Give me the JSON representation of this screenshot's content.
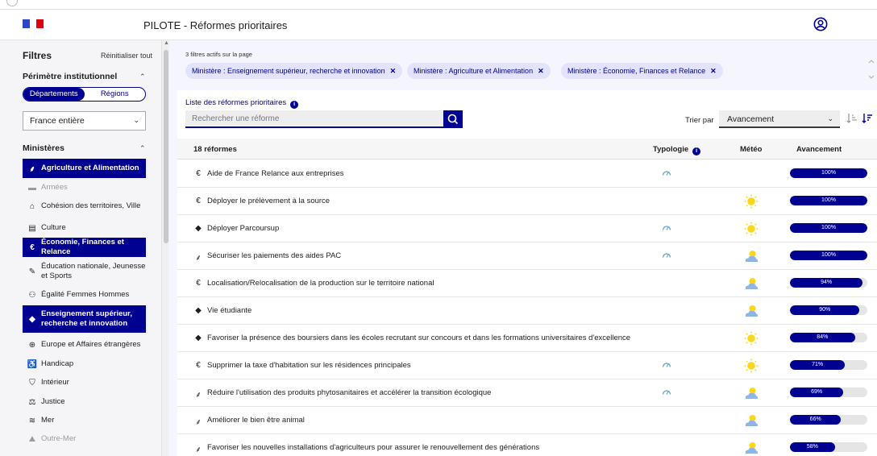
{
  "app": {
    "title": "PILOTE - Réformes prioritaires"
  },
  "sidebar": {
    "filters_title": "Filtres",
    "reset_label": "Réinitialiser tout",
    "perimetre_title": "Périmètre institutionnel",
    "toggle": {
      "left": "Départements",
      "right": "Régions",
      "selected": "Départements"
    },
    "territory_select": "France entière",
    "ministeres_title": "Ministères",
    "ministeres": [
      {
        "label": "Agriculture et Alimentation",
        "icon": "wheat-icon",
        "state": "active"
      },
      {
        "label": "Armées",
        "icon": "tank-icon",
        "state": "disabled"
      },
      {
        "label": "Cohésion des territoires, Ville",
        "icon": "house-icon",
        "state": "normal"
      },
      {
        "label": "Culture",
        "icon": "book-icon",
        "state": "normal"
      },
      {
        "label": "Économie, Finances et Relance",
        "icon": "euro-icon",
        "state": "active"
      },
      {
        "label": "Éducation nationale, Jeunesse et Sports",
        "icon": "pencil-icon",
        "state": "normal"
      },
      {
        "label": "Égalité Femmes Hommes",
        "icon": "people-icon",
        "state": "normal"
      },
      {
        "label": "Enseignement supérieur, recherche et innovation",
        "icon": "graduation-cap-icon",
        "state": "active"
      },
      {
        "label": "Europe et Affaires étrangères",
        "icon": "globe-icon",
        "state": "normal"
      },
      {
        "label": "Handicap",
        "icon": "wheelchair-icon",
        "state": "normal"
      },
      {
        "label": "Intérieur",
        "icon": "shield-icon",
        "state": "normal"
      },
      {
        "label": "Justice",
        "icon": "scales-icon",
        "state": "normal"
      },
      {
        "label": "Mer",
        "icon": "waves-icon",
        "state": "normal"
      },
      {
        "label": "Outre-Mer",
        "icon": "island-icon",
        "state": "disabled"
      }
    ]
  },
  "filters": {
    "count_text": "3 filtres actifs sur la page",
    "chips": [
      "Ministère : Enseignement supérieur, recherche et innovation",
      "Ministère : Agriculture et Alimentation",
      "Ministère : Économie, Finances et Relance"
    ]
  },
  "list": {
    "title": "Liste des réformes prioritaires",
    "search_placeholder": "Rechercher une réforme",
    "sort_label": "Trier par",
    "sort_value": "Avancement",
    "columns": {
      "count": "18 réformes",
      "typologie": "Typologie",
      "meteo": "Météo",
      "avancement": "Avancement"
    },
    "rows": [
      {
        "name": "Aide de France Relance aux entreprises",
        "icon": "euro-icon",
        "typologie": true,
        "meteo": "none",
        "progress": 100,
        "progress_label": "100%"
      },
      {
        "name": "Déployer le prélèvement à la source",
        "icon": "euro-icon",
        "typologie": false,
        "meteo": "sunny",
        "progress": 100,
        "progress_label": "100%"
      },
      {
        "name": "Déployer Parcoursup",
        "icon": "graduation-cap-icon",
        "typologie": true,
        "meteo": "sunny",
        "progress": 100,
        "progress_label": "100%"
      },
      {
        "name": "Sécuriser les paiements des aides PAC",
        "icon": "wheat-icon",
        "typologie": true,
        "meteo": "partly-cloudy",
        "progress": 100,
        "progress_label": "100%"
      },
      {
        "name": "Localisation/Relocalisation de la production sur le territoire national",
        "icon": "euro-icon",
        "typologie": false,
        "meteo": "partly-cloudy",
        "progress": 94,
        "progress_label": "94%"
      },
      {
        "name": "Vie étudiante",
        "icon": "graduation-cap-icon",
        "typologie": false,
        "meteo": "partly-cloudy",
        "progress": 90,
        "progress_label": "90%"
      },
      {
        "name": "Favoriser la présence des boursiers dans les écoles recrutant sur concours et dans les formations universitaires d'excellence",
        "icon": "graduation-cap-icon",
        "typologie": false,
        "meteo": "sunny",
        "progress": 84,
        "progress_label": "84%"
      },
      {
        "name": "Supprimer la taxe d'habitation sur les résidences principales",
        "icon": "euro-icon",
        "typologie": true,
        "meteo": "sunny",
        "progress": 71,
        "progress_label": "71%"
      },
      {
        "name": "Réduire l'utilisation des produits phytosanitaires et accélérer la transition écologique",
        "icon": "wheat-icon",
        "typologie": true,
        "meteo": "partly-cloudy",
        "progress": 69,
        "progress_label": "69%"
      },
      {
        "name": "Améliorer le bien être animal",
        "icon": "wheat-icon",
        "typologie": false,
        "meteo": "partly-cloudy",
        "progress": 66,
        "progress_label": "66%"
      },
      {
        "name": "Favoriser les nouvelles installations d'agriculteurs pour assurer le renouvellement des générations",
        "icon": "wheat-icon",
        "typologie": false,
        "meteo": "partly-cloudy",
        "progress": 58,
        "progress_label": "58%"
      }
    ]
  },
  "colors": {
    "primary": "#000091",
    "chip_bg": "#e3e3fd",
    "sun": "#f9d71c",
    "cloud": "#8fb4e6",
    "gauge": "#5aa5c8"
  }
}
